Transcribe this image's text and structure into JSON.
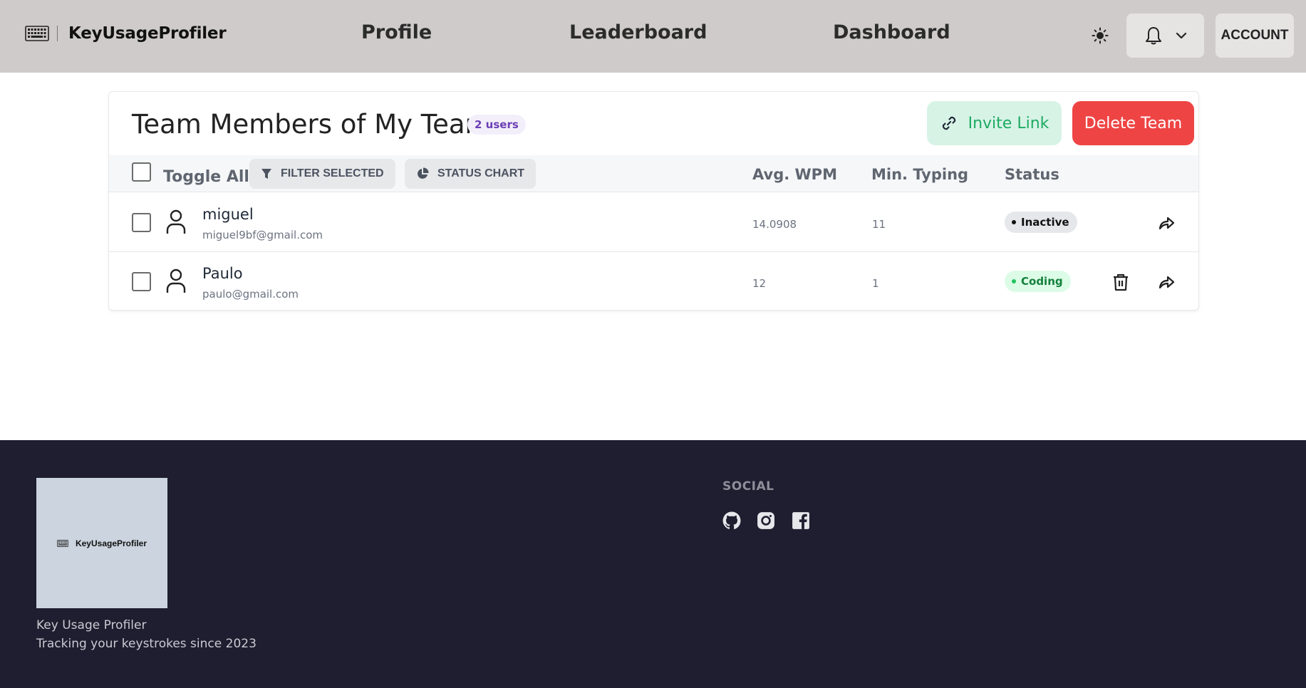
{
  "brand": {
    "name": "KeyUsageProfiler",
    "icon": "keyboard-icon"
  },
  "nav": {
    "links": [
      "Profile",
      "Leaderboard",
      "Dashboard"
    ],
    "account_label": "ACCOUNT",
    "theme_icon": "sun-icon",
    "notification_icon": "bell-icon"
  },
  "team": {
    "title": "Team Members of My Team",
    "user_count": "2 users",
    "invite_label": "Invite Link",
    "delete_label": "Delete Team",
    "toggle_all": "Toggle All",
    "filter_selected": "FILTER SELECTED",
    "status_chart": "STATUS CHART",
    "columns": {
      "wpm": "Avg. WPM",
      "typing": "Min. Typing",
      "status": "Status"
    },
    "members": [
      {
        "name": "miguel",
        "email": "miguel9bf@gmail.com",
        "wpm": "14.0908",
        "typing": "11",
        "status": "Inactive",
        "deletable": false
      },
      {
        "name": "Paulo",
        "email": "paulo@gmail.com",
        "wpm": "12",
        "typing": "1",
        "status": "Coding",
        "deletable": true
      }
    ]
  },
  "footer": {
    "logo_text": "KeyUsageProfiler",
    "tagline_1": "Key Usage Profiler",
    "tagline_2": "Tracking your keystrokes since 2023",
    "social_title": "SOCIAL",
    "social_icons": [
      "github-icon",
      "instagram-icon",
      "facebook-icon"
    ]
  },
  "colors": {
    "navbar_bg": "#d0cbcb",
    "footer_bg": "#1e1e30",
    "invite_bg": "#d7f3e6",
    "invite_text": "#1eaa62",
    "delete_bg": "#ef4444",
    "badge_text": "#6b3fb5",
    "coding_text": "#15803d"
  }
}
